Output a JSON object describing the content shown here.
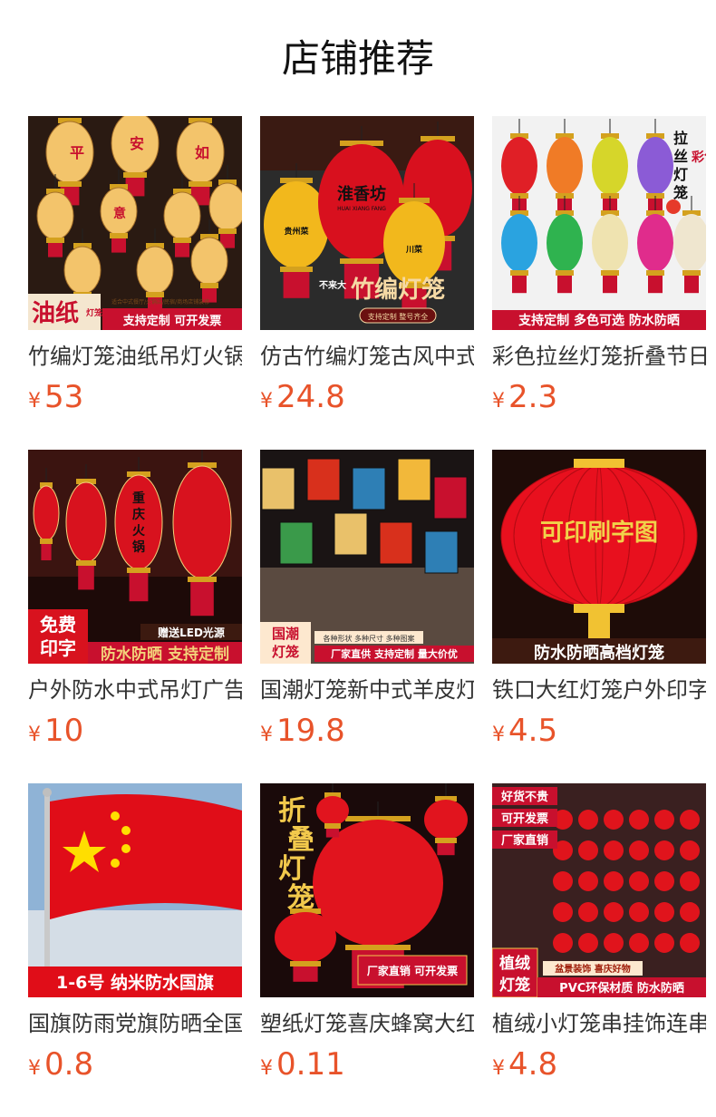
{
  "header": {
    "title": "店铺推荐"
  },
  "products": [
    {
      "name": "竹编灯笼油纸吊灯火锅店中式餐厅",
      "currency": "¥",
      "price": "53",
      "icon": "bamboo-lantern-image",
      "overlay": {
        "big": "油纸",
        "small": "灯笼",
        "banner": "支持定制 可开发票",
        "sub": "适合中式餐厅/火锅店/民宿/商场店铺装修",
        "lantern_chars": [
          "平",
          "安",
          "如",
          "意"
        ]
      },
      "colors": {
        "bg": "#2a1a12",
        "lantern": "#f3c46b",
        "accent": "#c8102e"
      }
    },
    {
      "name": "仿古竹编灯笼古风中式餐厅火锅店",
      "currency": "¥",
      "price": "24.8",
      "icon": "woven-lantern-image",
      "overlay": {
        "big": "竹编灯笼",
        "banner": "支持定制 整号齐全",
        "brand_a": "淮香坊",
        "brand_a_sub": "HUAI XIANG FANG",
        "brand_b": "贵州菜",
        "brand_c": "川菜",
        "sign": "不来大"
      },
      "colors": {
        "bg": "#2b2b2b",
        "lantern": "#d8101e",
        "accent": "#f2b81c"
      }
    },
    {
      "name": "彩色拉丝灯笼折叠节日装饰",
      "currency": "¥",
      "price": "2.3",
      "icon": "color-lanterns-image",
      "overlay": {
        "banner": "支持定制 多色可选 防水防晒",
        "side_a": "拉丝灯笼",
        "side_b": "彩色"
      },
      "colors": {
        "bg": "#f2f2f2",
        "accent": "#c8102e"
      }
    },
    {
      "name": "户外防水中式吊灯广告灯笼定制",
      "currency": "¥",
      "price": "10",
      "icon": "outdoor-lantern-image",
      "overlay": {
        "badge": "免费印字",
        "banner": "防水防晒 支持定制",
        "tag": "赠送LED光源",
        "lantern_text": "重庆火锅"
      },
      "colors": {
        "bg": "#3b1410",
        "lantern": "#d8121e",
        "accent": "#f3d27a"
      }
    },
    {
      "name": "国潮灯笼新中式羊皮灯笼定制",
      "currency": "¥",
      "price": "19.8",
      "icon": "guochao-lantern-image",
      "overlay": {
        "badge": "国潮灯笼",
        "line1": "各种形状 多种尺寸 多种图案",
        "banner": "厂家直供 支持定制 量大价优"
      },
      "colors": {
        "bg": "#2a2222",
        "accent": "#c8102e"
      }
    },
    {
      "name": "铁口大红灯笼户外印字定制",
      "currency": "¥",
      "price": "4.5",
      "icon": "red-lantern-image",
      "overlay": {
        "lantern_text": "可印刷字图",
        "banner": "防水防晒高档灯笼"
      },
      "colors": {
        "bg": "#1e0c08",
        "lantern": "#e8101e",
        "accent": "#f1c232"
      }
    },
    {
      "name": "国旗防雨党旗防晒全国通用",
      "currency": "¥",
      "price": "0.8",
      "icon": "flag-image",
      "overlay": {
        "banner": "1-6号 纳米防水国旗"
      },
      "colors": {
        "bg": "#8fb3d6",
        "flag": "#e00d18",
        "star": "#ffde00"
      }
    },
    {
      "name": "塑纸灯笼喜庆蜂窝大红灯笼",
      "currency": "¥",
      "price": "0.11",
      "icon": "honeycomb-lantern-image",
      "overlay": {
        "vertical": "折叠灯笼",
        "banner": "厂家直销 可开发票"
      },
      "colors": {
        "bg": "#1a0a0a",
        "lantern": "#e1141e",
        "accent": "#f2c94c"
      }
    },
    {
      "name": "植绒小灯笼串挂饰连串装饰",
      "currency": "¥",
      "price": "4.8",
      "icon": "flocked-lantern-string-image",
      "overlay": {
        "tags": [
          "好货不贵",
          "可开发票",
          "厂家直销"
        ],
        "badge": "植绒灯笼",
        "line1": "盆景装饰 喜庆好物",
        "banner": "PVC环保材质 防水防晒"
      },
      "colors": {
        "bg": "#3a2020",
        "lantern": "#e0141c",
        "accent": "#c8102e"
      }
    }
  ]
}
